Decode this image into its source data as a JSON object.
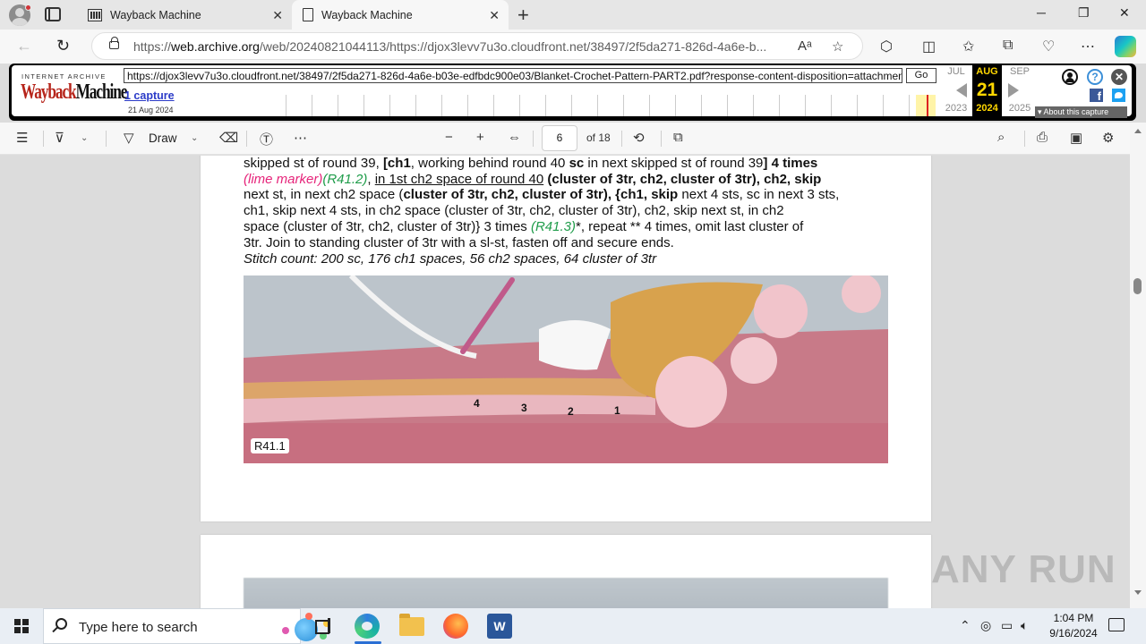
{
  "browser": {
    "tabs": [
      {
        "label": "Wayback Machine",
        "active": false
      },
      {
        "label": "Wayback Machine",
        "active": true
      }
    ],
    "url_prefix": "https://",
    "url_domain": "web.archive.org",
    "url_rest": "/web/20240821044113/https://djox3levv7u3o.cloudfront.net/38497/2f5da271-826d-4a6e-b..."
  },
  "wayback": {
    "ia_label": "INTERNET ARCHIVE",
    "logo_red": "Wayback",
    "logo_black": "Machine",
    "archived_url": "https://djox3levv7u3o.cloudfront.net/38497/2f5da271-826d-4a6e-b03e-edfbdc900e03/Blanket-Crochet-Pattern-PART2.pdf?response-content-disposition=attachment",
    "go_label": "Go",
    "captures_label": "1 capture",
    "captures_date": "21 Aug 2024",
    "prev_month": "JUL",
    "cur_month": "AUG",
    "next_month": "SEP",
    "prev_year": "2023",
    "cur_day": "21",
    "cur_year": "2024",
    "next_year": "2025",
    "about_label": "About this capture"
  },
  "pdf_toolbar": {
    "draw_label": "Draw",
    "page_number": "6",
    "page_total": "of 18"
  },
  "document": {
    "line1_pre": "skipped st of round 39, ",
    "line1_b1": "[ch1",
    "line1_mid": ", working behind round 40 ",
    "line1_b2": "sc",
    "line1_mid2": " in next skipped st of round 39",
    "line1_b3": "] 4 times",
    "lime": "(lime marker)",
    "r412": "(R41.2)",
    "line2_u": "in 1st ch2 space of round 40",
    "line2_b": "(cluster of 3tr, ch2, cluster of 3tr), ch2, skip",
    "line3": "next st, in next ch2 space (",
    "line3_b": "cluster of 3tr, ch2, cluster of 3tr), {ch1, skip",
    "line3_rest": " next 4 sts, sc in next 3 sts,",
    "line4": "ch1, skip next 4 sts, in ch2 space (cluster of 3tr, ch2, cluster of 3tr), ch2, skip next st, in ch2",
    "line5_pre": "space (cluster of 3tr, ch2, cluster of 3tr)} 3 times ",
    "r413": "(R41.3)",
    "line5_post": "*, repeat ** 4 times, omit last cluster of",
    "line6": "3tr. Join to standing cluster of 3tr with a sl-st, fasten off and secure ends.",
    "stitch_count": "Stitch count: 200 sc, 176 ch1 spaces, 56 ch2 spaces, 64 cluster of 3tr",
    "photo_label": "R41.1",
    "photo_numbers": [
      "4",
      "3",
      "2",
      "1"
    ]
  },
  "watermark": "ANY RUN",
  "taskbar": {
    "search_placeholder": "Type here to search",
    "time": "1:04 PM",
    "date": "9/16/2024"
  }
}
